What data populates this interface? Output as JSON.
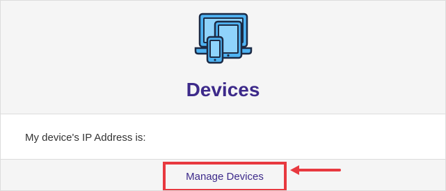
{
  "header": {
    "title": "Devices",
    "icon": "devices-icon"
  },
  "ip_section": {
    "label": "My device's IP Address is:",
    "value": ""
  },
  "footer": {
    "manage_label": "Manage Devices"
  },
  "annotation": {
    "icon": "arrow-left-icon",
    "color": "#e8393f"
  },
  "colors": {
    "accent": "#3d2a8a",
    "icon_blue": "#4fb3f2",
    "highlight": "#e8393f"
  }
}
